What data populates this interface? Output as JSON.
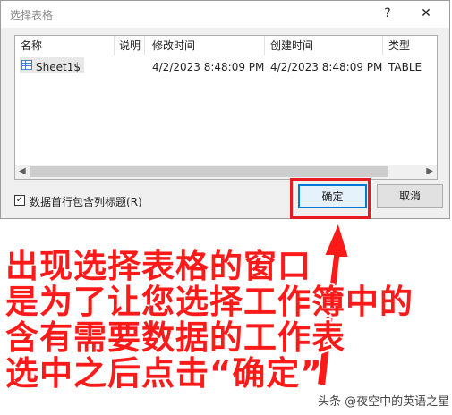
{
  "dialog": {
    "title": "选择表格",
    "help_label": "?",
    "close_label": "✕"
  },
  "table": {
    "headers": {
      "name": "名称",
      "description": "说明",
      "modified": "修改时间",
      "created": "创建时间",
      "type": "类型"
    },
    "rows": [
      {
        "name": "Sheet1$",
        "description": "",
        "modified": "4/2/2023 8:48:09 PM",
        "created": "4/2/2023 8:48:09 PM",
        "type": "TABLE"
      }
    ]
  },
  "scrollbar": {
    "left_arrow": "◀",
    "right_arrow": "▶"
  },
  "checkbox": {
    "checked_mark": "✓",
    "label": "数据首行包含列标题(R)"
  },
  "buttons": {
    "ok": "确定",
    "cancel": "取消"
  },
  "annotation": {
    "line1": "出现选择表格的窗口",
    "line2": "是为了让您选择工作簿中的",
    "line3": "含有需要数据的工作表",
    "line4": "选中之后点击“确定”"
  },
  "watermark": "头条 @夜空中的英语之星",
  "colors": {
    "highlight": "#e51d23",
    "annotation_text": "#ff1a1a",
    "ok_border": "#0078d7"
  }
}
